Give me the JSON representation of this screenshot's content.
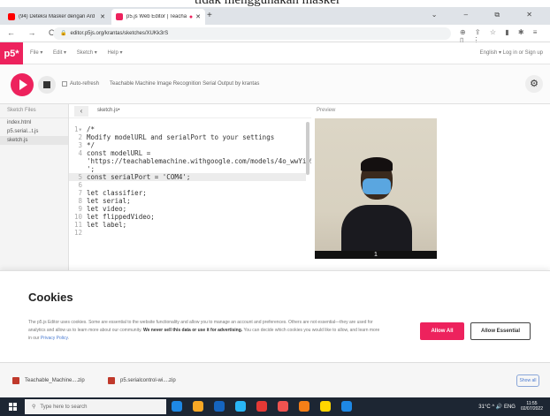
{
  "top_caption": "tidak menggunakan masker",
  "browser": {
    "tabs": [
      {
        "title": "(94) Deteksi Masker dengan Ard",
        "favicon_color": "#ff0000"
      },
      {
        "title": "p5.js Web Editor | Teachabl",
        "favicon_color": "#ed225d"
      }
    ],
    "new_tab": "+",
    "window_controls": "⌄ – ⧉ ✕",
    "nav": "← → C",
    "url": "editor.p5js.org/krantas/sketches/XUKk3rS",
    "ext_icons": "⊕ ⇪ ☆ ▮ ✱ ≡ ▯ ⋮"
  },
  "p5": {
    "logo": "p5*",
    "menu": [
      "File ▾",
      "Edit ▾",
      "Sketch ▾",
      "Help ▾"
    ],
    "right_links": "English ▾   Log in  or  Sign up",
    "autorefresh_label": "Auto-refresh",
    "sketch_title": "Teachable Machine Image Recognition Serial Output  by krantas",
    "settings_icon": "⚙"
  },
  "sidebar": {
    "header": "Sketch Files",
    "files": [
      "index.html",
      "p5.serial...t.js",
      "sketch.js"
    ],
    "active_index": 2
  },
  "editor": {
    "back": "‹",
    "filename": "sketch.js•",
    "lines": [
      {
        "n": "1▾",
        "t": "/*",
        "hl": false
      },
      {
        "n": "2",
        "t": "Modify modelURL and serialPort to your settings",
        "hl": false
      },
      {
        "n": "3",
        "t": "*/",
        "hl": false
      },
      {
        "n": "4",
        "t": "const modelURL =",
        "hl": false
      },
      {
        "n": "",
        "t": "'https://teachablemachine.withgoogle.com/models/4o_wwYiQ5/",
        "hl": false
      },
      {
        "n": "",
        "t": "';",
        "hl": false
      },
      {
        "n": "5",
        "t": "const serialPort = 'COM4';",
        "hl": true
      },
      {
        "n": "6",
        "t": "",
        "hl": false
      },
      {
        "n": "7",
        "t": "let classifier;",
        "hl": false
      },
      {
        "n": "8",
        "t": "let serial;",
        "hl": false
      },
      {
        "n": "9",
        "t": "let video;",
        "hl": false
      },
      {
        "n": "10",
        "t": "let flippedVideo;",
        "hl": false
      },
      {
        "n": "11",
        "t": "let label;",
        "hl": false
      },
      {
        "n": "12",
        "t": "",
        "hl": false
      }
    ]
  },
  "preview": {
    "header": "Preview",
    "label": "1"
  },
  "cookies": {
    "title": "Cookies",
    "text1": "The p5.js Editor uses cookies. Some are essential to the website functionality and allow you to manage an account and preferences. Others are not essential—they are used for analytics and allow us to learn more about our community. ",
    "text_bold": "We never sell this data or use it for advertising.",
    "text2": " You can decide which cookies you would like to allow, and learn more in our ",
    "link": "Privacy Policy",
    "text3": ".",
    "allow_all": "Allow All",
    "allow_essential": "Allow Essential"
  },
  "downloads": {
    "items": [
      {
        "name": "Teachable_Machine....zip",
        "color": "#c0392b"
      },
      {
        "name": "p5.serialcontrol-wi....zip",
        "color": "#c0392b"
      }
    ],
    "show_all": "Show all"
  },
  "taskbar": {
    "search_placeholder": "Type here to search",
    "app_colors": [
      "#1e88e5",
      "#f9a825",
      "#1565c0",
      "#29b6f6",
      "#e53935",
      "#ef5350",
      "#f57f17",
      "#ffd600",
      "#1e88e5"
    ],
    "tray": "31°C  ^  🔊  ENG",
    "time": "11:55",
    "date": "02/07/2022"
  }
}
